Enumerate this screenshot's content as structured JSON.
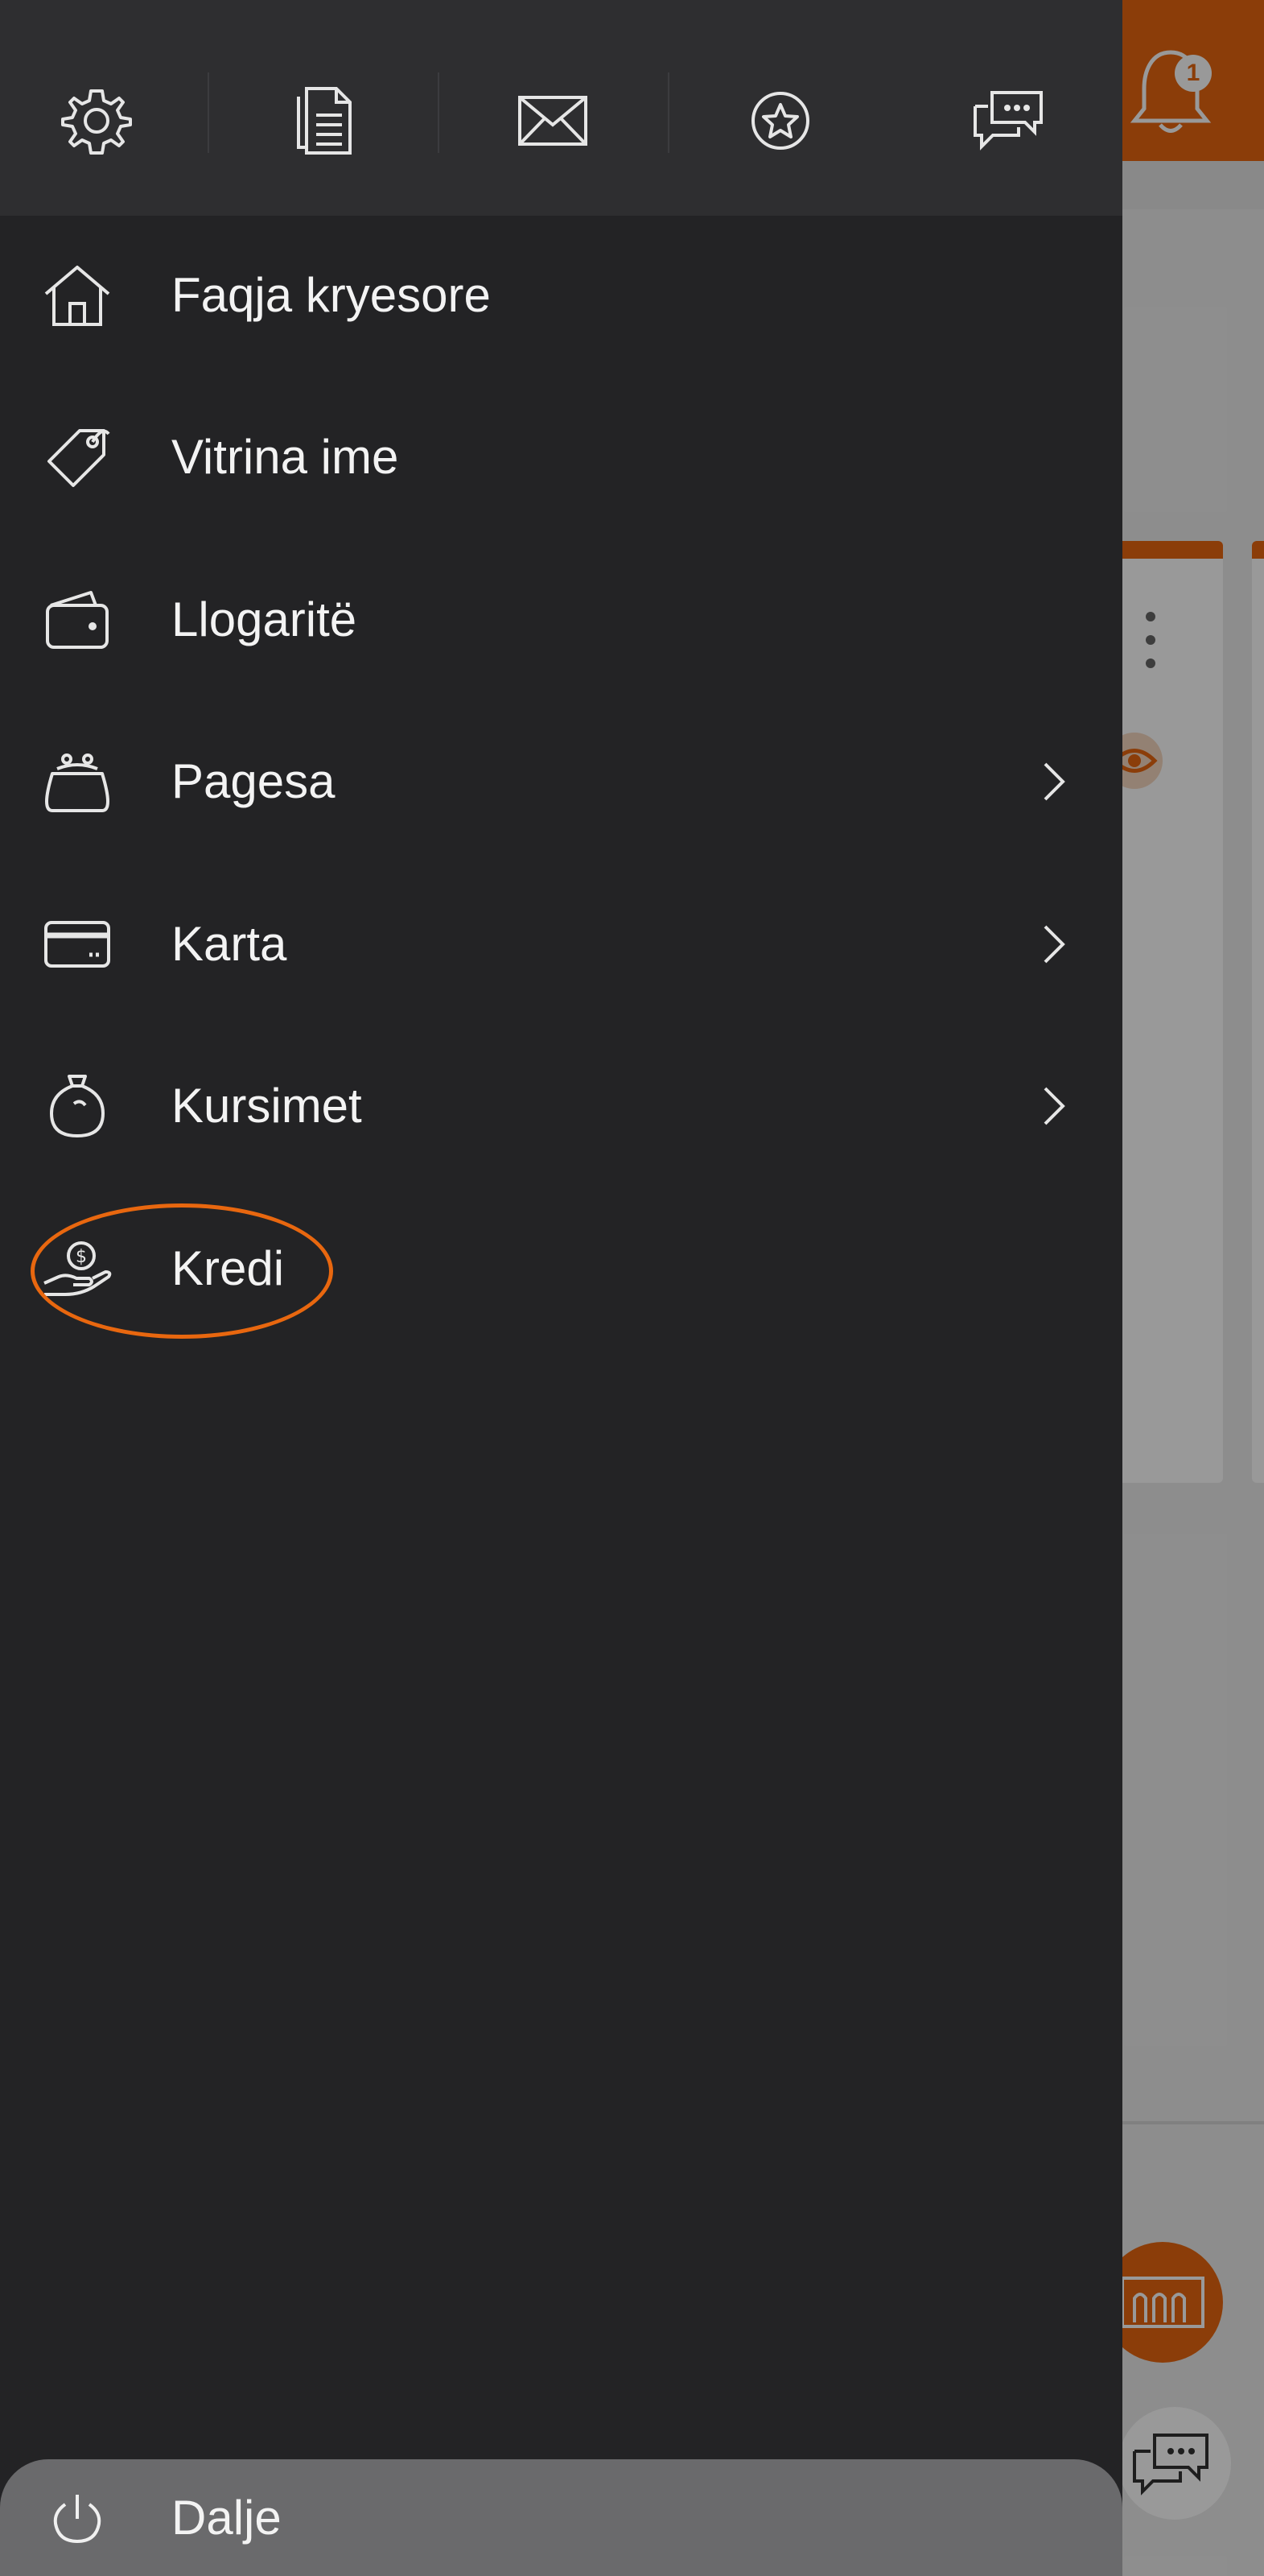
{
  "app": {
    "notification_count": "1",
    "accent_color": "#e8670f",
    "drawer_bg": "#232325"
  },
  "toolbar": {
    "items": [
      {
        "name": "settings",
        "icon": "gear-icon"
      },
      {
        "name": "documents",
        "icon": "document-list-icon"
      },
      {
        "name": "messages",
        "icon": "envelope-icon"
      },
      {
        "name": "favorites",
        "icon": "star-circle-icon"
      },
      {
        "name": "chat",
        "icon": "chat-bubbles-icon"
      }
    ]
  },
  "menu": {
    "items": [
      {
        "label": "Faqja kryesore",
        "icon": "home-icon",
        "has_submenu": false
      },
      {
        "label": "Vitrina ime",
        "icon": "tag-icon",
        "has_submenu": false
      },
      {
        "label": "Llogaritë",
        "icon": "wallet-icon",
        "has_submenu": false
      },
      {
        "label": "Pagesa",
        "icon": "purse-icon",
        "has_submenu": true
      },
      {
        "label": "Karta",
        "icon": "credit-card-icon",
        "has_submenu": true
      },
      {
        "label": "Kursimet",
        "icon": "piggy-jar-icon",
        "has_submenu": true
      },
      {
        "label": "Kredi",
        "icon": "hand-coin-icon",
        "has_submenu": false,
        "highlighted": true
      }
    ]
  },
  "logout": {
    "label": "Dalje",
    "icon": "power-icon"
  }
}
